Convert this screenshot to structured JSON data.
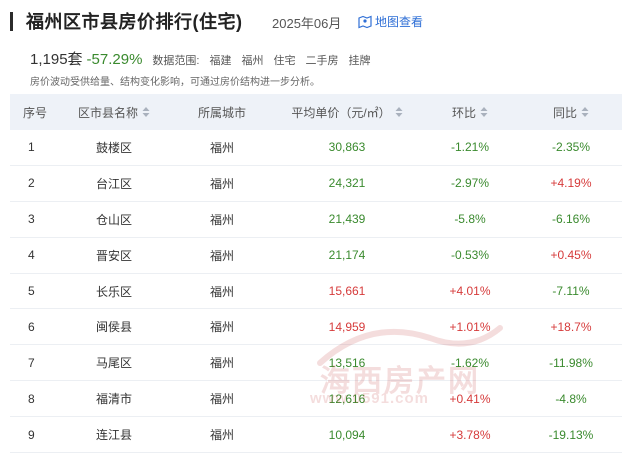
{
  "header": {
    "title": "福州区市县房价排行(住宅)",
    "date": "2025年06月",
    "map_link": "地图查看",
    "map_icon": "map-icon"
  },
  "stats": {
    "count": "1,195套",
    "change_pct": "-57.29%",
    "range_label": "数据范围:",
    "tags": [
      "福建",
      "福州",
      "住宅",
      "二手房",
      "挂牌"
    ]
  },
  "note": "房价波动受供给量、结构变化影响，可通过房价结构进一步分析。",
  "table": {
    "columns": [
      "序号",
      "区市县名称",
      "所属城市",
      "平均单价（元/㎡）",
      "环比",
      "同比"
    ],
    "rows": [
      {
        "rank": "1",
        "district": "鼓楼区",
        "city": "福州",
        "price": "30,863",
        "mom": "-1.21%",
        "yoy": "-2.35%"
      },
      {
        "rank": "2",
        "district": "台江区",
        "city": "福州",
        "price": "24,321",
        "mom": "-2.97%",
        "yoy": "+4.19%"
      },
      {
        "rank": "3",
        "district": "仓山区",
        "city": "福州",
        "price": "21,439",
        "mom": "-5.8%",
        "yoy": "-6.16%"
      },
      {
        "rank": "4",
        "district": "晋安区",
        "city": "福州",
        "price": "21,174",
        "mom": "-0.53%",
        "yoy": "+0.45%"
      },
      {
        "rank": "5",
        "district": "长乐区",
        "city": "福州",
        "price": "15,661",
        "mom": "+4.01%",
        "yoy": "-7.11%"
      },
      {
        "rank": "6",
        "district": "闽侯县",
        "city": "福州",
        "price": "14,959",
        "mom": "+1.01%",
        "yoy": "+18.7%"
      },
      {
        "rank": "7",
        "district": "马尾区",
        "city": "福州",
        "price": "13,516",
        "mom": "-1.62%",
        "yoy": "-11.98%"
      },
      {
        "rank": "8",
        "district": "福清市",
        "city": "福州",
        "price": "12,616",
        "mom": "+0.41%",
        "yoy": "-4.8%"
      },
      {
        "rank": "9",
        "district": "连江县",
        "city": "福州",
        "price": "10,094",
        "mom": "+3.78%",
        "yoy": "-19.13%"
      }
    ]
  },
  "watermark": {
    "text": "海西房产网",
    "url": "www.0591.com"
  },
  "colors": {
    "up": "#d63b3b",
    "down": "#3a8a2e",
    "header_bg": "#eef2f8",
    "link": "#2f6fd6"
  }
}
